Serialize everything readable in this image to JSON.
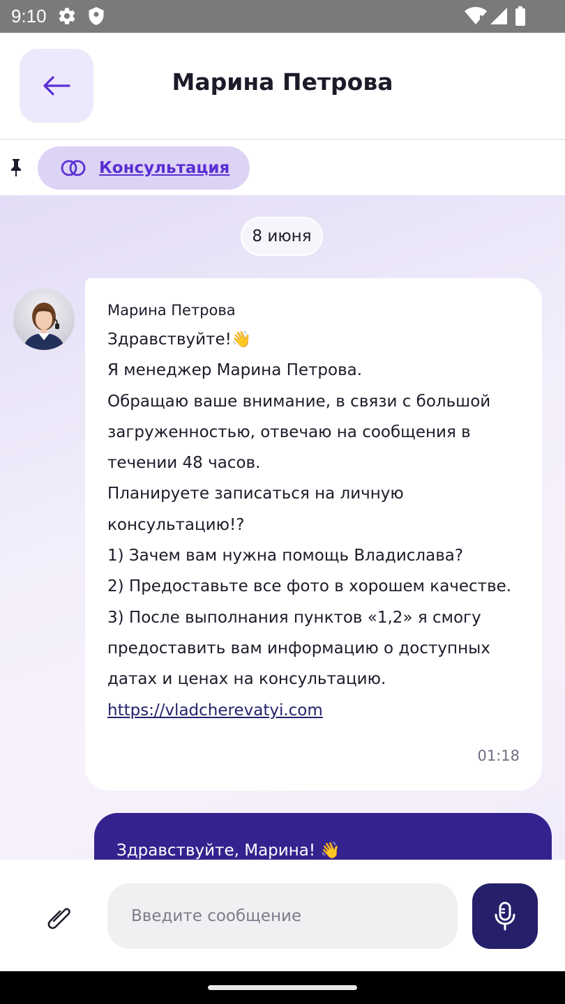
{
  "status_bar": {
    "time": "9:10",
    "icons": [
      "gear-icon",
      "shield-icon",
      "wifi-icon",
      "signal-icon",
      "battery-icon"
    ]
  },
  "header": {
    "back_icon": "arrow-left-icon",
    "title": "Марина Петрова"
  },
  "pinned": {
    "pin_icon": "pin-icon",
    "chip_icon": "link-icon",
    "chip_label": "Консультация"
  },
  "chat": {
    "date_label": "8 июня",
    "incoming": {
      "sender": "Марина Петрова",
      "lines": [
        "Здравствуйте!👋",
        "Я менеджер Марина Петрова.",
        "Обращаю ваше внимание, в связи с большой",
        "загруженностью, отвечаю на сообщения в",
        "течении 48 часов.",
        "Планируете записаться на личную",
        "консультацию!?",
        "1) Зачем вам нужна помощь Владислава?",
        "2) Предоставьте все фото в хорошем качестве.",
        "3) После выполнания пунктов «1,2» я смогу",
        "предоставить вам информацию о доступных",
        "датах и ценах на консультацию."
      ],
      "link": "https://vladcherevatyi.com",
      "time": "01:18"
    },
    "outgoing": {
      "text": "Здравствуйте, Марина! 👋"
    }
  },
  "composer": {
    "attach_icon": "paperclip-icon",
    "placeholder": "Введите сообщение",
    "mic_icon": "microphone-icon"
  },
  "colors": {
    "accent": "#5a2fd3",
    "outgoing_bubble": "#34228f",
    "mic_button": "#26206a",
    "chip_bg": "#ddd3f5"
  }
}
